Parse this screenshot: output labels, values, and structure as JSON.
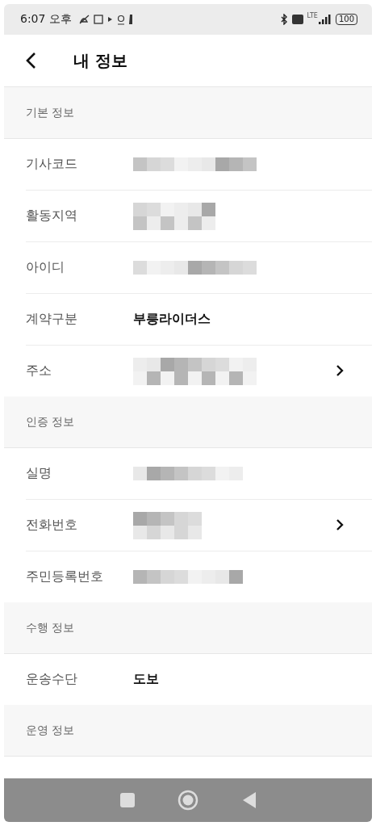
{
  "status_bar": {
    "time": "6:07 오후",
    "network": "LTE",
    "battery": "100"
  },
  "header": {
    "title": "내 정보"
  },
  "sections": [
    {
      "title": "기본 정보",
      "rows": [
        {
          "label": "기사코드",
          "kind": "redacted",
          "chevron": false
        },
        {
          "label": "활동지역",
          "kind": "redacted",
          "chevron": false
        },
        {
          "label": "아이디",
          "kind": "redacted",
          "chevron": false
        },
        {
          "label": "계약구분",
          "kind": "text",
          "value": "부릉라이더스",
          "chevron": false
        },
        {
          "label": "주소",
          "kind": "redacted",
          "chevron": true
        }
      ]
    },
    {
      "title": "인증 정보",
      "rows": [
        {
          "label": "실명",
          "kind": "redacted",
          "chevron": false
        },
        {
          "label": "전화번호",
          "kind": "redacted",
          "chevron": true
        },
        {
          "label": "주민등록번호",
          "kind": "redacted",
          "chevron": false
        }
      ]
    },
    {
      "title": "수행 정보",
      "rows": [
        {
          "label": "운송수단",
          "kind": "text",
          "value": "도보",
          "chevron": false
        }
      ]
    },
    {
      "title": "운영 정보"
    }
  ]
}
